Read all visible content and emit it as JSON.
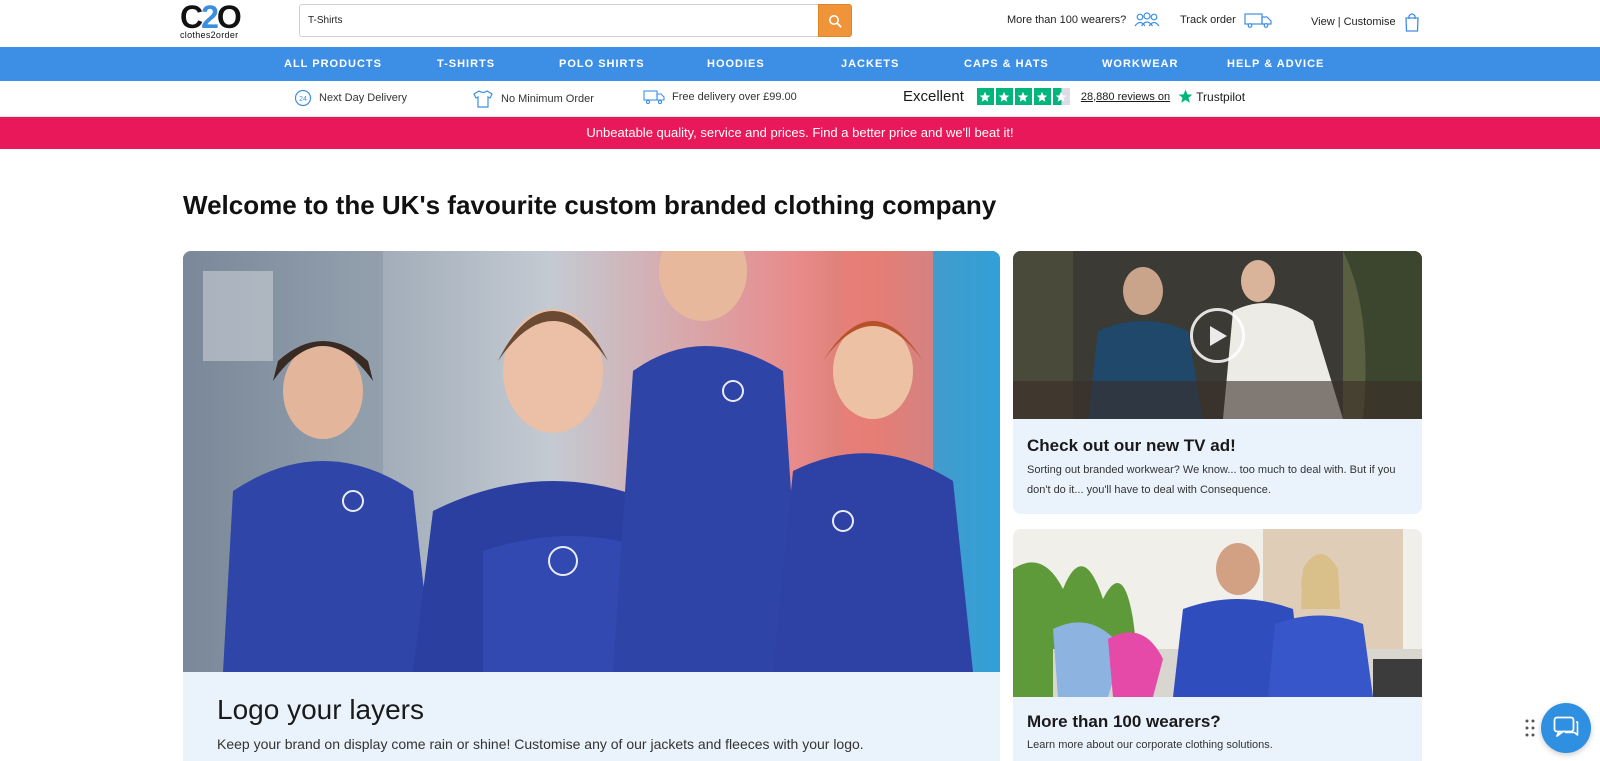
{
  "header": {
    "logo_mark": "C2O",
    "logo_text": "clothes2order",
    "search": {
      "value": "T-Shirts",
      "placeholder": "Search"
    },
    "wearers_label": "More than 100 wearers?",
    "track_label": "Track order",
    "view_label": "View | Customise",
    "icons": {
      "search": "search-icon",
      "wearers": "people-icon",
      "track": "truck-icon",
      "bag": "shopping-bag-icon"
    }
  },
  "nav": {
    "items": [
      {
        "label": "ALL PRODUCTS"
      },
      {
        "label": "T-SHIRTS"
      },
      {
        "label": "POLO SHIRTS"
      },
      {
        "label": "HOODIES"
      },
      {
        "label": "JACKETS"
      },
      {
        "label": "CAPS & HATS"
      },
      {
        "label": "WORKWEAR"
      },
      {
        "label": "HELP & ADVICE"
      }
    ]
  },
  "usp": {
    "items": [
      {
        "label": "Next Day Delivery",
        "icon": "24-hour-icon"
      },
      {
        "label": "No Minimum Order",
        "icon": "tshirt-icon"
      },
      {
        "label": "Free delivery over £99.00",
        "icon": "delivery-icon"
      }
    ],
    "trustpilot": {
      "rating_word": "Excellent",
      "stars": 4.5,
      "reviews_label": "28,880 reviews on",
      "brand": "Trustpilot"
    }
  },
  "promo": {
    "text": "Unbeatable quality, service and prices. Find a better price and we'll beat it!"
  },
  "main": {
    "heading": "Welcome to the UK's favourite custom branded clothing company",
    "hero": {
      "title": "Logo your layers",
      "text": "Keep your brand on display come rain or shine! Customise any of our jackets and fleeces with your logo."
    },
    "cards": [
      {
        "title": "Check out our new TV ad!",
        "text": "Sorting out branded workwear? We know... too much to deal with. But if you don't do it... you'll have to deal with Consequence.",
        "icon": "play-icon"
      },
      {
        "title": "More than 100 wearers?",
        "text": "Learn more about our corporate clothing solutions."
      }
    ]
  },
  "colors": {
    "nav_blue": "#3d8fe6",
    "promo_pink": "#e8185a",
    "search_orange": "#f0943a",
    "card_bg": "#eaf3fc",
    "trustpilot_green": "#00b67a"
  },
  "chat": {
    "icon": "chat-icon"
  }
}
